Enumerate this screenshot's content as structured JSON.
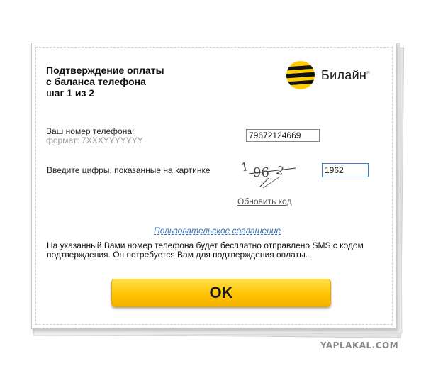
{
  "header": {
    "title_line1": "Подтверждение оплаты",
    "title_line2": "с баланса телефона",
    "title_line3": "шаг 1 из 2"
  },
  "brand": {
    "name": "Билайн",
    "logo_icon": "beeline-stripes-icon",
    "colors": {
      "yellow": "#ffcc00",
      "black": "#111111"
    }
  },
  "phone": {
    "label": "Ваш номер телефона:",
    "hint": "формат: 7XXXYYYYYYY",
    "value": "79672124669"
  },
  "captcha": {
    "label": "Введите цифры, показанные на картинке",
    "image_text": "1 96 2",
    "value": "1962",
    "refresh_label": "Обновить код"
  },
  "agreement": {
    "link_label": "Пользовательское соглашение"
  },
  "info": {
    "text": "На указанный Вами номер телефона будет бесплатно отправлено SMS с кодом подтверждения. Он потребуется Вам для подтверждения оплаты."
  },
  "actions": {
    "ok_label": "OK",
    "accent": "#ffc400"
  },
  "watermark": {
    "text": "YAPLAKAL.COM"
  }
}
